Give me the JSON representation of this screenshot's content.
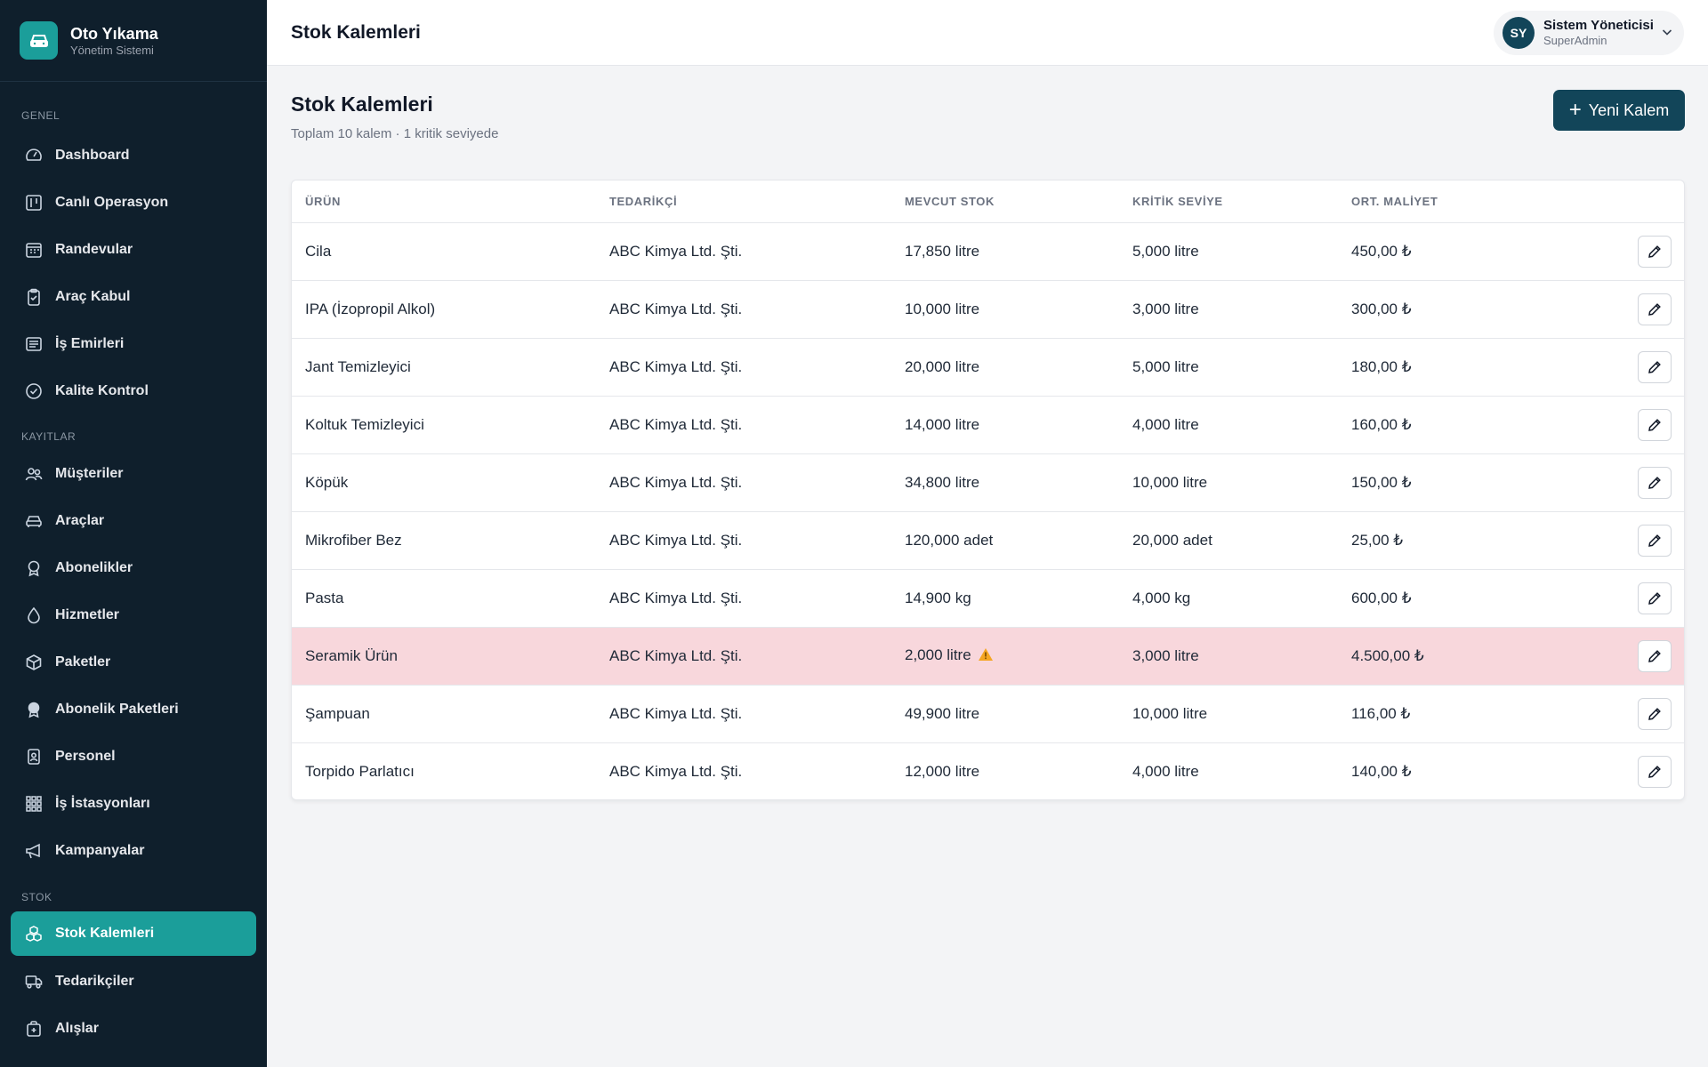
{
  "brand": {
    "title": "Oto Yıkama",
    "subtitle": "Yönetim Sistemi"
  },
  "sidebar": {
    "sections": [
      {
        "label": "GENEL"
      },
      {
        "label": "KAYITLAR"
      },
      {
        "label": "STOK"
      }
    ],
    "items": [
      {
        "label": "Dashboard",
        "icon": "gauge-icon"
      },
      {
        "label": "Canlı Operasyon",
        "icon": "kanban-icon"
      },
      {
        "label": "Randevular",
        "icon": "calendar-icon"
      },
      {
        "label": "Araç Kabul",
        "icon": "clipboard-check-icon"
      },
      {
        "label": "İş Emirleri",
        "icon": "list-icon"
      },
      {
        "label": "Kalite Kontrol",
        "icon": "check-circle-icon"
      },
      {
        "label": "Müşteriler",
        "icon": "users-icon"
      },
      {
        "label": "Araçlar",
        "icon": "car-icon"
      },
      {
        "label": "Abonelikler",
        "icon": "badge-icon"
      },
      {
        "label": "Hizmetler",
        "icon": "droplet-icon"
      },
      {
        "label": "Paketler",
        "icon": "box-icon"
      },
      {
        "label": "Abonelik Paketleri",
        "icon": "award-icon"
      },
      {
        "label": "Personel",
        "icon": "id-badge-icon"
      },
      {
        "label": "İş İstasyonları",
        "icon": "grid-icon"
      },
      {
        "label": "Kampanyalar",
        "icon": "megaphone-icon"
      },
      {
        "label": "Stok Kalemleri",
        "icon": "boxes-icon",
        "active": true
      },
      {
        "label": "Tedarikçiler",
        "icon": "truck-icon"
      },
      {
        "label": "Alışlar",
        "icon": "bag-plus-icon"
      }
    ]
  },
  "header": {
    "title": "Stok Kalemleri",
    "user": {
      "initials": "SY",
      "name": "Sistem Yöneticisi",
      "role": "SuperAdmin"
    }
  },
  "page": {
    "title": "Stok Kalemleri",
    "subtitle": "Toplam 10 kalem · 1 kritik seviyede",
    "new_button": "Yeni Kalem"
  },
  "table": {
    "columns": [
      "ÜRÜN",
      "TEDARİKÇİ",
      "MEVCUT STOK",
      "KRİTİK SEVİYE",
      "ORT. MALİYET"
    ],
    "rows": [
      {
        "product": "Cila",
        "supplier": "ABC Kimya Ltd. Şti.",
        "stock": "17,850 litre",
        "critical": "5,000 litre",
        "cost": "450,00 ₺"
      },
      {
        "product": "IPA (İzopropil Alkol)",
        "supplier": "ABC Kimya Ltd. Şti.",
        "stock": "10,000 litre",
        "critical": "3,000 litre",
        "cost": "300,00 ₺"
      },
      {
        "product": "Jant Temizleyici",
        "supplier": "ABC Kimya Ltd. Şti.",
        "stock": "20,000 litre",
        "critical": "5,000 litre",
        "cost": "180,00 ₺"
      },
      {
        "product": "Koltuk Temizleyici",
        "supplier": "ABC Kimya Ltd. Şti.",
        "stock": "14,000 litre",
        "critical": "4,000 litre",
        "cost": "160,00 ₺"
      },
      {
        "product": "Köpük",
        "supplier": "ABC Kimya Ltd. Şti.",
        "stock": "34,800 litre",
        "critical": "10,000 litre",
        "cost": "150,00 ₺"
      },
      {
        "product": "Mikrofiber Bez",
        "supplier": "ABC Kimya Ltd. Şti.",
        "stock": "120,000 adet",
        "critical": "20,000 adet",
        "cost": "25,00 ₺"
      },
      {
        "product": "Pasta",
        "supplier": "ABC Kimya Ltd. Şti.",
        "stock": "14,900 kg",
        "critical": "4,000 kg",
        "cost": "600,00 ₺"
      },
      {
        "product": "Seramik Ürün",
        "supplier": "ABC Kimya Ltd. Şti.",
        "stock": "2,000 litre",
        "critical": "3,000 litre",
        "cost": "4.500,00 ₺",
        "is_critical": true
      },
      {
        "product": "Şampuan",
        "supplier": "ABC Kimya Ltd. Şti.",
        "stock": "49,900 litre",
        "critical": "10,000 litre",
        "cost": "116,00 ₺"
      },
      {
        "product": "Torpido Parlatıcı",
        "supplier": "ABC Kimya Ltd. Şti.",
        "stock": "12,000 litre",
        "critical": "4,000 litre",
        "cost": "140,00 ₺"
      }
    ]
  },
  "colors": {
    "sidebar_bg": "#0f1f2c",
    "accent": "#1b9e9a",
    "primary_button": "#124559",
    "critical_row": "#f8d7dc",
    "warning": "#f5a623"
  }
}
